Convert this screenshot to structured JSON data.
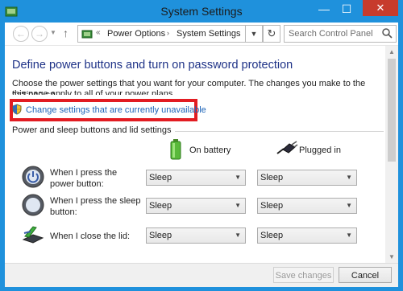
{
  "window": {
    "title": "System Settings",
    "controls": {
      "minimize": "—",
      "maximize": "☐",
      "close": "✕"
    }
  },
  "navbar": {
    "breadcrumb_prefix": "«",
    "breadcrumb": [
      "Power Options",
      "System Settings"
    ],
    "breadcrumb_separator": "›",
    "search_placeholder": "Search Control Panel"
  },
  "main": {
    "heading": "Define power buttons and turn on password protection",
    "description_line1": "Choose the power settings that you want for your computer. The changes you make to the settings on",
    "description_line2": "this page apply to all of your power plans.",
    "change_link": "Change settings that are currently unavailable",
    "group_label": "Power and sleep buttons and lid settings",
    "columns": {
      "battery": "On battery",
      "plugged": "Plugged in"
    },
    "rows": [
      {
        "label": "When I press the power button:",
        "battery": "Sleep",
        "plugged": "Sleep",
        "icon": "power-button-icon"
      },
      {
        "label": "When I press the sleep button:",
        "battery": "Sleep",
        "plugged": "Sleep",
        "icon": "sleep-button-icon"
      },
      {
        "label": "When I close the lid:",
        "battery": "Sleep",
        "plugged": "Sleep",
        "icon": "laptop-lid-icon"
      }
    ]
  },
  "footer": {
    "save": "Save changes",
    "cancel": "Cancel"
  },
  "colors": {
    "titlebar": "#1f91dc",
    "close": "#c73b2c",
    "heading": "#1e3287",
    "link": "#1b63b8",
    "highlight": "#e21c22"
  }
}
